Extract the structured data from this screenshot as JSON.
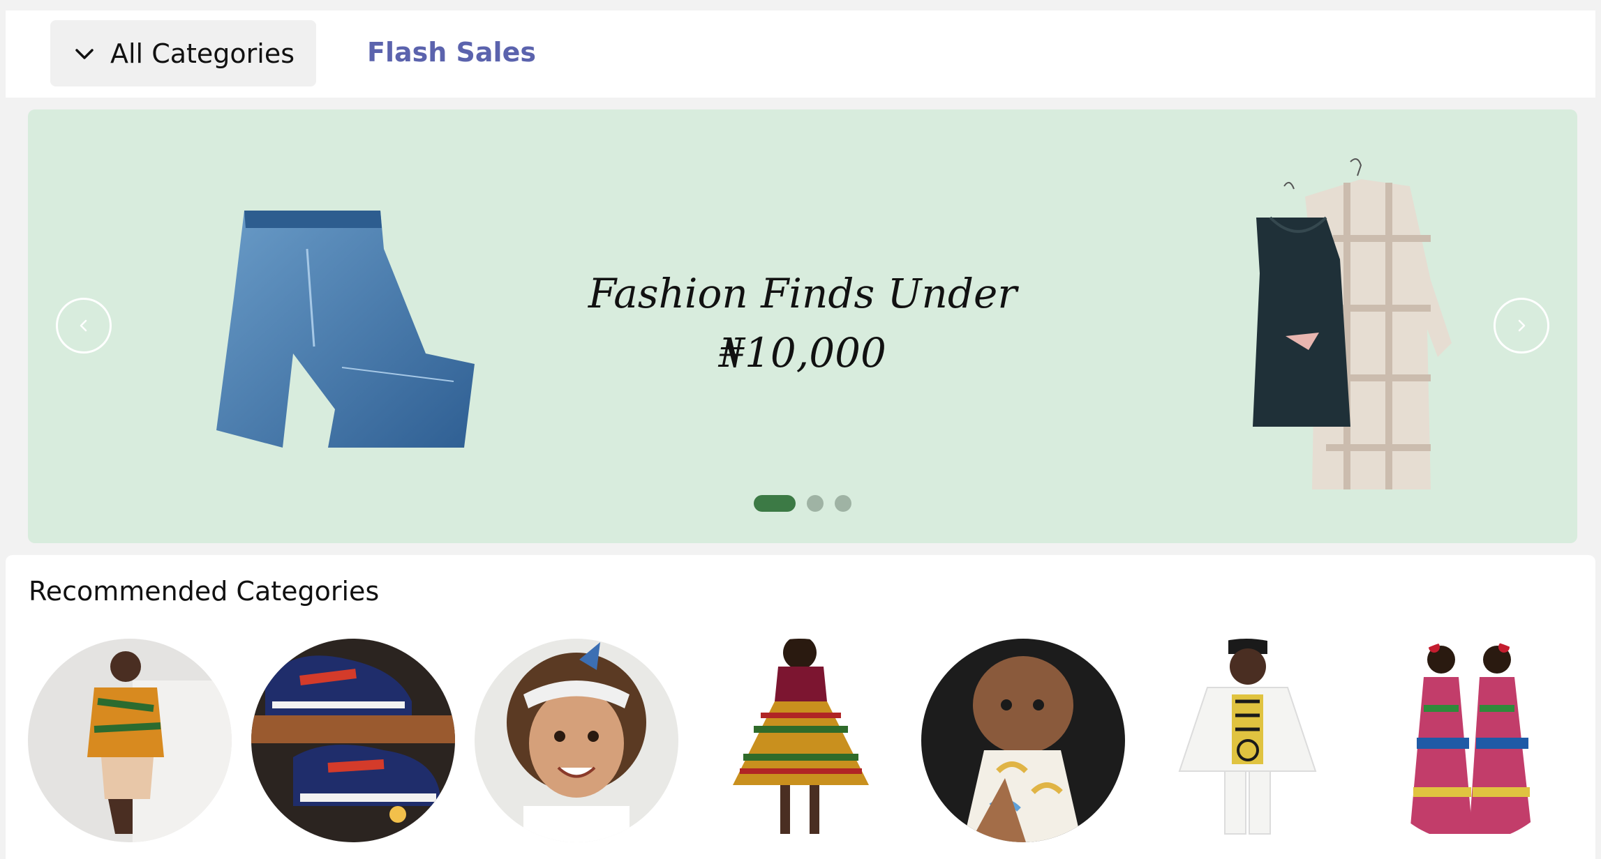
{
  "nav": {
    "all_categories": "All Categories",
    "flash_sales": "Flash Sales"
  },
  "hero": {
    "title": "Fashion Finds Under",
    "price": "₦10,000",
    "active_slide": 1,
    "slide_count": 3
  },
  "recommended": {
    "heading": "Recommended Categories"
  },
  "colors": {
    "hero_bg": "#d8ecdd",
    "flash_sales": "#5b63ad",
    "active_dot": "#3c7a45"
  }
}
